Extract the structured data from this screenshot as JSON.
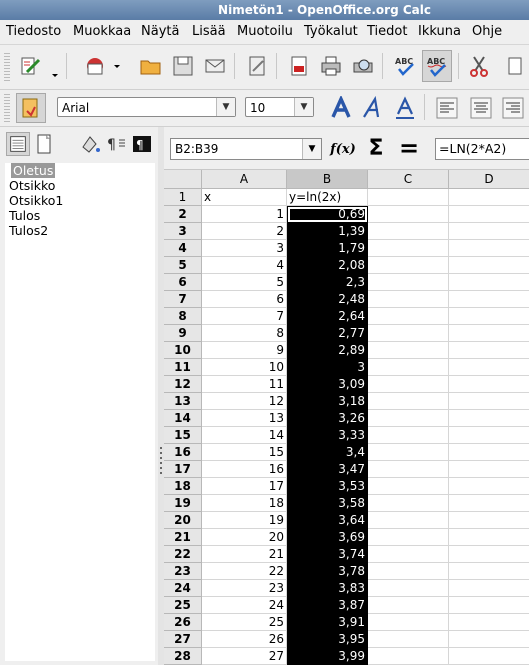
{
  "window": {
    "title": "Nimetön1 - OpenOffice.org Calc"
  },
  "menu": [
    "Tiedosto",
    "Muokkaa",
    "Näytä",
    "Lisää",
    "Muotoilu",
    "Työkalut",
    "Tiedot",
    "Ikkuna",
    "Ohje"
  ],
  "toolbar_format": {
    "font_name": "Arial",
    "font_size": "10"
  },
  "icons": {
    "standard": [
      "edit-file-icon",
      "open-icon",
      "save-icon",
      "email-icon",
      "edit-doc-icon",
      "export-pdf-icon",
      "print-icon",
      "page-preview-icon",
      "spellcheck-icon",
      "autospellcheck-icon",
      "cut-icon"
    ],
    "format": [
      "styles-icon",
      "bold-icon",
      "italic-icon",
      "underline-icon",
      "align-left-icon",
      "align-center-icon",
      "align-right-icon"
    ]
  },
  "styles_panel": {
    "items": [
      "Oletus",
      "Otsikko",
      "Otsikko1",
      "Tulos",
      "Tulos2"
    ],
    "selected": "Oletus"
  },
  "formula_bar": {
    "name_box": "B2:B39",
    "formula": "=LN(2*A2)",
    "fx": "f(x)",
    "sum": "Σ",
    "equals": "="
  },
  "sheet": {
    "columns": [
      "A",
      "B",
      "C",
      "D"
    ],
    "active_column": "B",
    "header_row": {
      "row": "1",
      "A": "x",
      "B": "y=ln(2x)"
    },
    "rows": [
      {
        "row": "2",
        "A": "1",
        "B": "0,69"
      },
      {
        "row": "3",
        "A": "2",
        "B": "1,39"
      },
      {
        "row": "4",
        "A": "3",
        "B": "1,79"
      },
      {
        "row": "5",
        "A": "4",
        "B": "2,08"
      },
      {
        "row": "6",
        "A": "5",
        "B": "2,3"
      },
      {
        "row": "7",
        "A": "6",
        "B": "2,48"
      },
      {
        "row": "8",
        "A": "7",
        "B": "2,64"
      },
      {
        "row": "9",
        "A": "8",
        "B": "2,77"
      },
      {
        "row": "10",
        "A": "9",
        "B": "2,89"
      },
      {
        "row": "11",
        "A": "10",
        "B": "3"
      },
      {
        "row": "12",
        "A": "11",
        "B": "3,09"
      },
      {
        "row": "13",
        "A": "12",
        "B": "3,18"
      },
      {
        "row": "14",
        "A": "13",
        "B": "3,26"
      },
      {
        "row": "15",
        "A": "14",
        "B": "3,33"
      },
      {
        "row": "16",
        "A": "15",
        "B": "3,4"
      },
      {
        "row": "17",
        "A": "16",
        "B": "3,47"
      },
      {
        "row": "18",
        "A": "17",
        "B": "3,53"
      },
      {
        "row": "19",
        "A": "18",
        "B": "3,58"
      },
      {
        "row": "20",
        "A": "19",
        "B": "3,64"
      },
      {
        "row": "21",
        "A": "20",
        "B": "3,69"
      },
      {
        "row": "22",
        "A": "21",
        "B": "3,74"
      },
      {
        "row": "23",
        "A": "22",
        "B": "3,78"
      },
      {
        "row": "24",
        "A": "23",
        "B": "3,83"
      },
      {
        "row": "25",
        "A": "24",
        "B": "3,87"
      },
      {
        "row": "26",
        "A": "25",
        "B": "3,91"
      },
      {
        "row": "27",
        "A": "26",
        "B": "3,95"
      },
      {
        "row": "28",
        "A": "27",
        "B": "3,99"
      }
    ]
  }
}
